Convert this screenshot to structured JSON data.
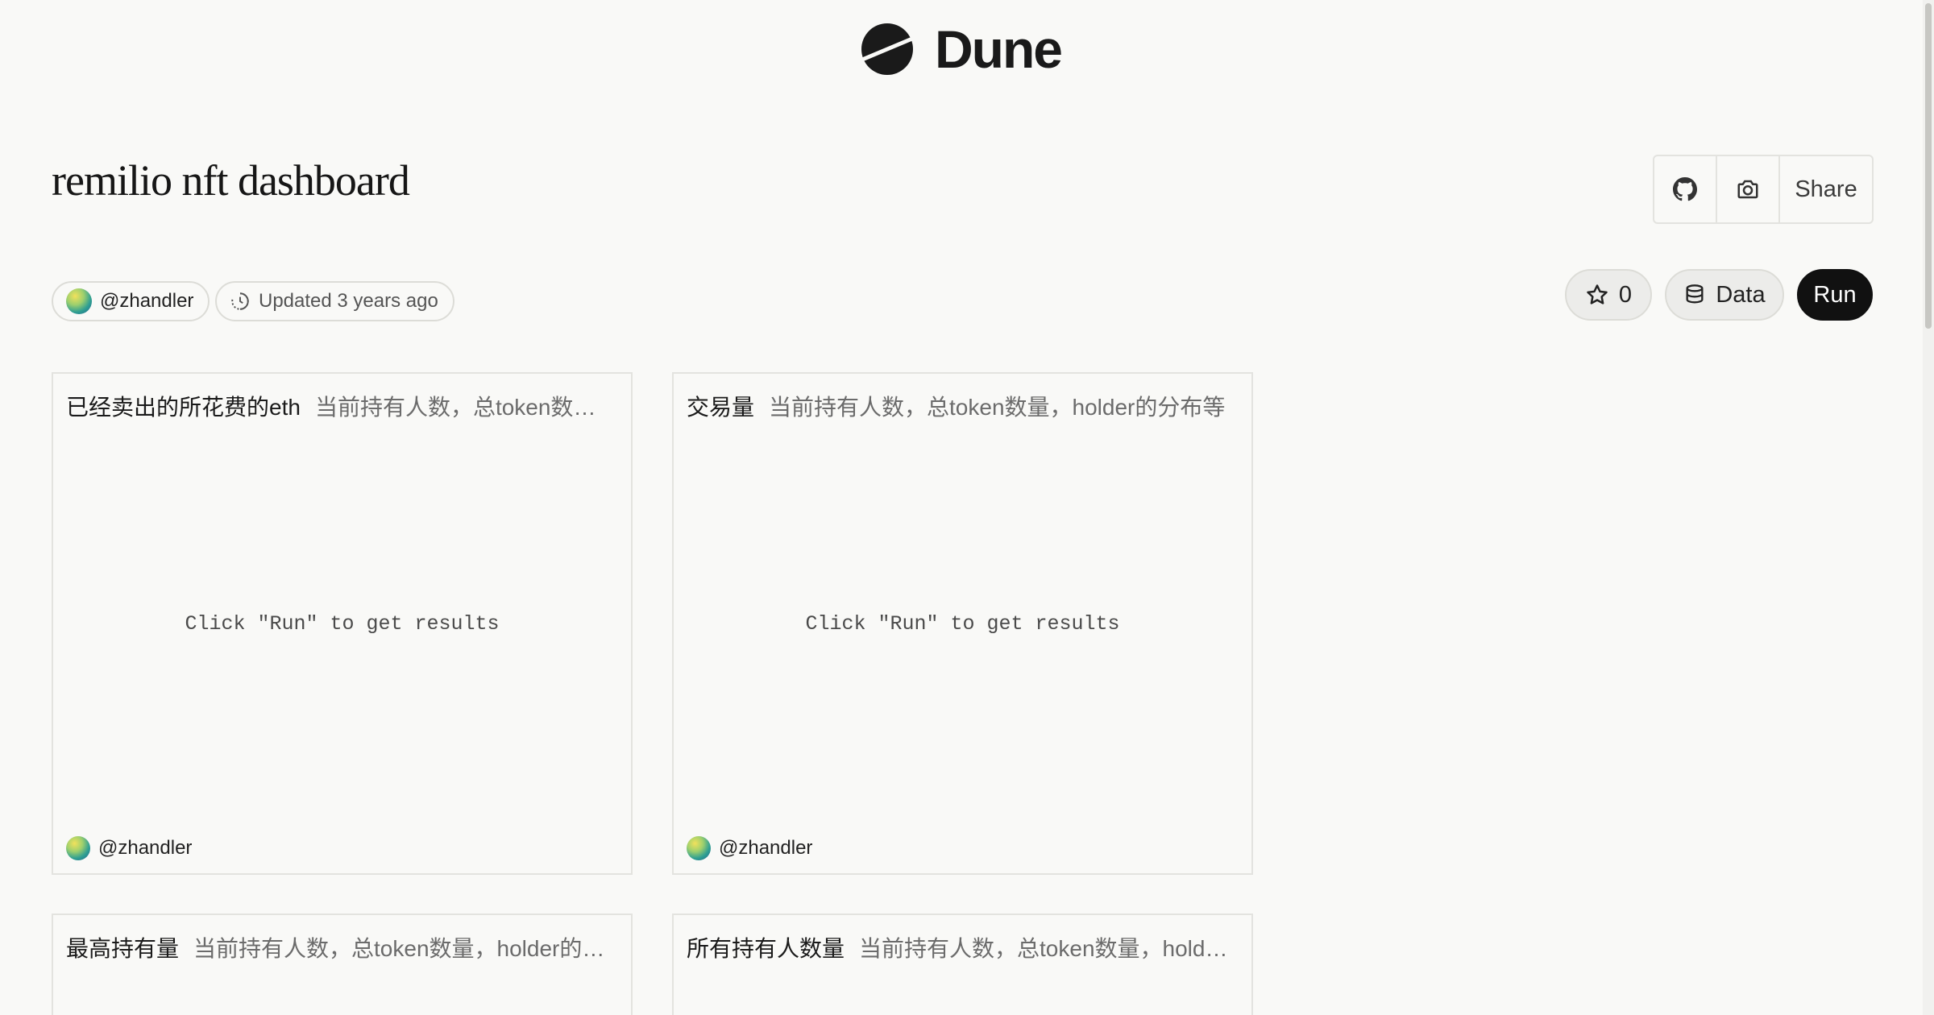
{
  "brand": {
    "name": "Dune"
  },
  "dashboard": {
    "title": "remilio nft dashboard",
    "author": "@zhandler",
    "updated": "Updated 3 years ago"
  },
  "toolbar": {
    "github_icon": "github-icon",
    "screenshot_icon": "camera-icon",
    "share_label": "Share"
  },
  "actions": {
    "star_count": "0",
    "data_label": "Data",
    "run_label": "Run"
  },
  "cards": [
    {
      "title": "已经卖出的所花费的eth",
      "description": "当前持有人数，总token数量…",
      "placeholder": "Click \"Run\" to get results",
      "author": "@zhandler"
    },
    {
      "title": "交易量",
      "description": "当前持有人数，总token数量，holder的分布等",
      "placeholder": "Click \"Run\" to get results",
      "author": "@zhandler"
    },
    {
      "title": "最高持有量",
      "description": "当前持有人数，总token数量，holder的…"
    },
    {
      "title": "所有持有人数量",
      "description": "当前持有人数，总token数量，holde…"
    }
  ]
}
